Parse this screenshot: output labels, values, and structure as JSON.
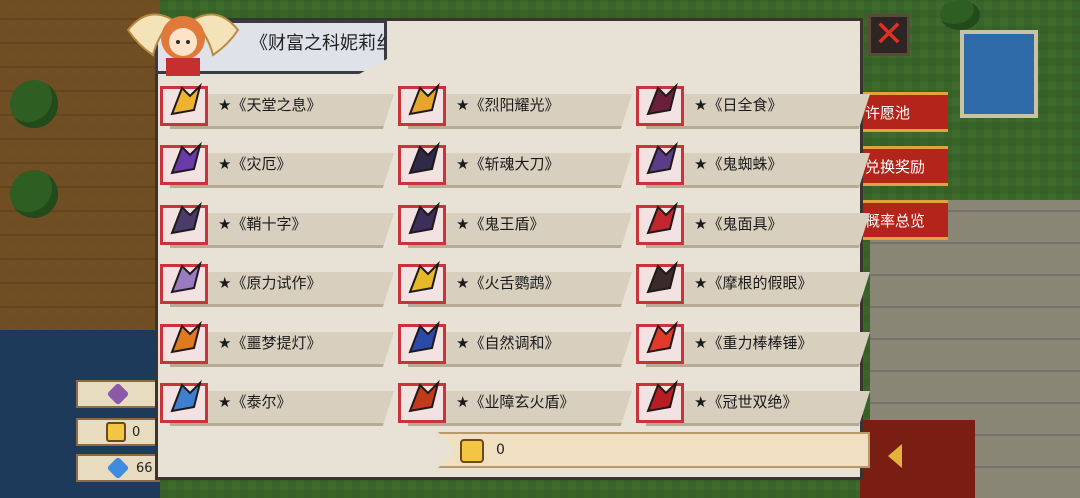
{
  "title": "《财富之科妮莉丝》",
  "close_icon": "close-icon",
  "side_buttons": [
    "许愿池",
    "兑换奖励",
    "概率总览"
  ],
  "resources": [
    {
      "icon": "crystal-icon",
      "value": ""
    },
    {
      "icon": "coin-icon",
      "value": "0"
    },
    {
      "icon": "gem-icon",
      "value": "66"
    }
  ],
  "items": [
    {
      "label": "★《天堂之息》",
      "icon": "crown-icon",
      "color": "#f0b330"
    },
    {
      "label": "★《烈阳耀光》",
      "icon": "staff-icon",
      "color": "#e6a52d"
    },
    {
      "label": "★《日全食》",
      "icon": "trident-icon",
      "color": "#6b1f3d"
    },
    {
      "label": "★《灾厄》",
      "icon": "sword-icon",
      "color": "#6a3aa8"
    },
    {
      "label": "★《斩魂大刀》",
      "icon": "blade-icon",
      "color": "#2e2a48"
    },
    {
      "label": "★《鬼蜘蛛》",
      "icon": "gun-icon",
      "color": "#5a3d86"
    },
    {
      "label": "★《鞘十字》",
      "icon": "shuriken-icon",
      "color": "#4a3c6a"
    },
    {
      "label": "★《鬼王盾》",
      "icon": "shield-icon",
      "color": "#3c2f5a"
    },
    {
      "label": "★《鬼面具》",
      "icon": "mask-icon",
      "color": "#c0262b"
    },
    {
      "label": "★《原力试作》",
      "icon": "blaster-icon",
      "color": "#9a7bc0"
    },
    {
      "label": "★《火舌鹦鹉》",
      "icon": "parrot-gun-icon",
      "color": "#e7b82a"
    },
    {
      "label": "★《摩根的假眼》",
      "icon": "eye-icon",
      "color": "#3a2a2a"
    },
    {
      "label": "★《噩梦提灯》",
      "icon": "lantern-icon",
      "color": "#e07a1e"
    },
    {
      "label": "★《自然调和》",
      "icon": "glove-icon",
      "color": "#2a4aa8"
    },
    {
      "label": "★《重力棒棒锤》",
      "icon": "lollipop-icon",
      "color": "#e23a2a"
    },
    {
      "label": "★《泰尔》",
      "icon": "helmet-icon",
      "color": "#3f7fd0"
    },
    {
      "label": "★《业障玄火盾》",
      "icon": "fire-shield-icon",
      "color": "#c23a1a"
    },
    {
      "label": "★《冠世双绝》",
      "icon": "claws-icon",
      "color": "#b81d24"
    }
  ],
  "bottom": {
    "icon": "coin-icon",
    "value": "0"
  }
}
